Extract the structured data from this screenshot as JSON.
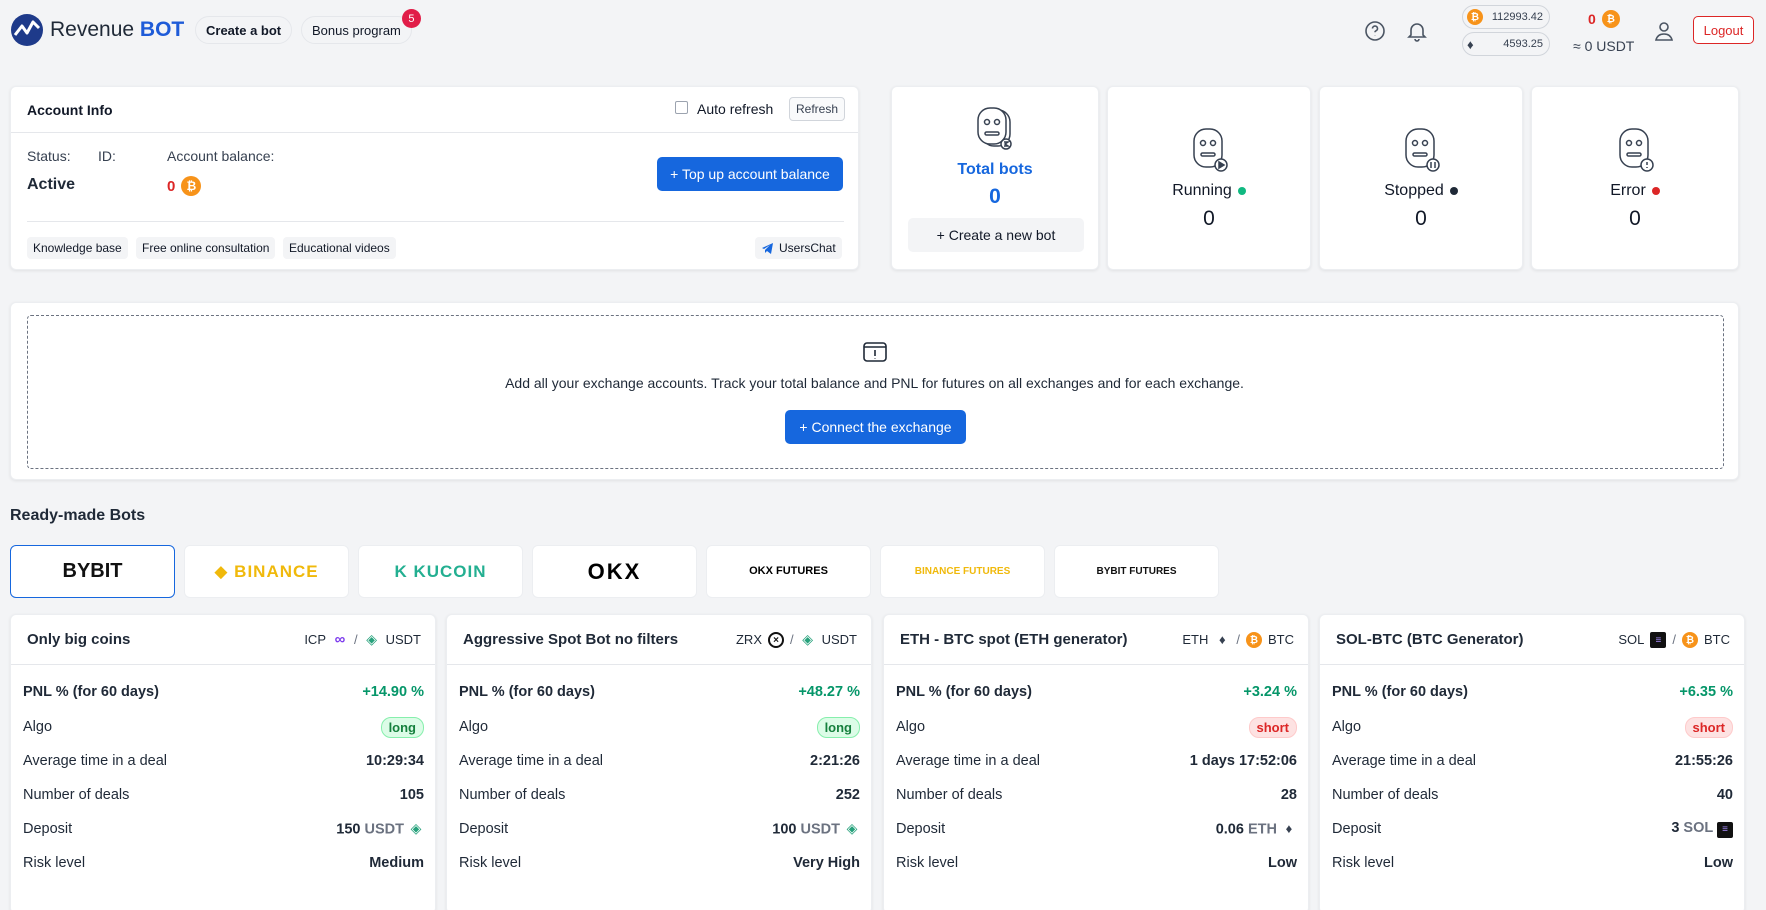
{
  "header": {
    "logo_text_a": "Revenue",
    "logo_text_b": "BOT",
    "create_bot_label": "Create a bot",
    "bonus_label": "Bonus program",
    "bonus_count": "5",
    "btc_rate": "112993.42",
    "eth_rate": "4593.25",
    "balance_btc": "0",
    "balance_usdt": "≈ 0 USDT",
    "logout_label": "Logout"
  },
  "account": {
    "title": "Account Info",
    "auto_refresh_label": "Auto refresh",
    "refresh_label": "Refresh",
    "status_label": "Status:",
    "status_value": "Active",
    "id_label": "ID:",
    "balance_label": "Account balance:",
    "balance_value": "0",
    "top_up_label": "+ Top up account balance",
    "links": [
      "Knowledge base",
      "Free online consultation",
      "Educational videos"
    ],
    "chat_label": "UsersChat"
  },
  "stats": {
    "total_label": "Total bots",
    "total_value": "0",
    "create_new_label": "+ Create a new bot",
    "running_label": "Running",
    "running_value": "0",
    "stopped_label": "Stopped",
    "stopped_value": "0",
    "error_label": "Error",
    "error_value": "0"
  },
  "exchange": {
    "description": "Add all your exchange accounts. Track your total balance and PNL for futures on all exchanges and for each exchange.",
    "connect_label": "+ Connect the exchange"
  },
  "ready_made": {
    "title": "Ready-made Bots",
    "tabs": [
      "BYBIT",
      "BINANCE",
      "KUCOIN",
      "OKX",
      "OKX FUTURES",
      "BINANCE FUTURES",
      "BYBIT FUTURES"
    ],
    "active_tab": "BYBIT"
  },
  "bots": [
    {
      "name": "Only big coins",
      "base": "ICP",
      "quote": "USDT",
      "pnl_label": "PNL % (for 60 days)",
      "pnl": "+14.90 %",
      "algo_label": "Algo",
      "algo": "long",
      "avg_label": "Average time in a deal",
      "avg": "10:29:34",
      "deals_label": "Number of deals",
      "deals": "105",
      "deposit_label": "Deposit",
      "deposit": "150",
      "deposit_unit": "USDT",
      "risk_label": "Risk level",
      "risk": "Medium"
    },
    {
      "name": "Aggressive Spot Bot no filters",
      "base": "ZRX",
      "quote": "USDT",
      "pnl_label": "PNL % (for 60 days)",
      "pnl": "+48.27 %",
      "algo_label": "Algo",
      "algo": "long",
      "avg_label": "Average time in a deal",
      "avg": "2:21:26",
      "deals_label": "Number of deals",
      "deals": "252",
      "deposit_label": "Deposit",
      "deposit": "100",
      "deposit_unit": "USDT",
      "risk_label": "Risk level",
      "risk": "Very High"
    },
    {
      "name": "ETH - BTC spot (ETH generator)",
      "base": "ETH",
      "quote": "BTC",
      "pnl_label": "PNL % (for 60 days)",
      "pnl": "+3.24 %",
      "algo_label": "Algo",
      "algo": "short",
      "avg_label": "Average time in a deal",
      "avg": "1 days 17:52:06",
      "deals_label": "Number of deals",
      "deals": "28",
      "deposit_label": "Deposit",
      "deposit": "0.06",
      "deposit_unit": "ETH",
      "risk_label": "Risk level",
      "risk": "Low"
    },
    {
      "name": "SOL-BTC (BTC Generator)",
      "base": "SOL",
      "quote": "BTC",
      "pnl_label": "PNL % (for 60 days)",
      "pnl": "+6.35 %",
      "algo_label": "Algo",
      "algo": "short",
      "avg_label": "Average time in a deal",
      "avg": "21:55:26",
      "deals_label": "Number of deals",
      "deals": "40",
      "deposit_label": "Deposit",
      "deposit": "3",
      "deposit_unit": "SOL",
      "risk_label": "Risk level",
      "risk": "Low"
    }
  ],
  "colors": {
    "accent": "#1667de",
    "positive": "#059669",
    "danger": "#dc2626",
    "btc": "#f7931a",
    "usdt": "#26a17b"
  }
}
